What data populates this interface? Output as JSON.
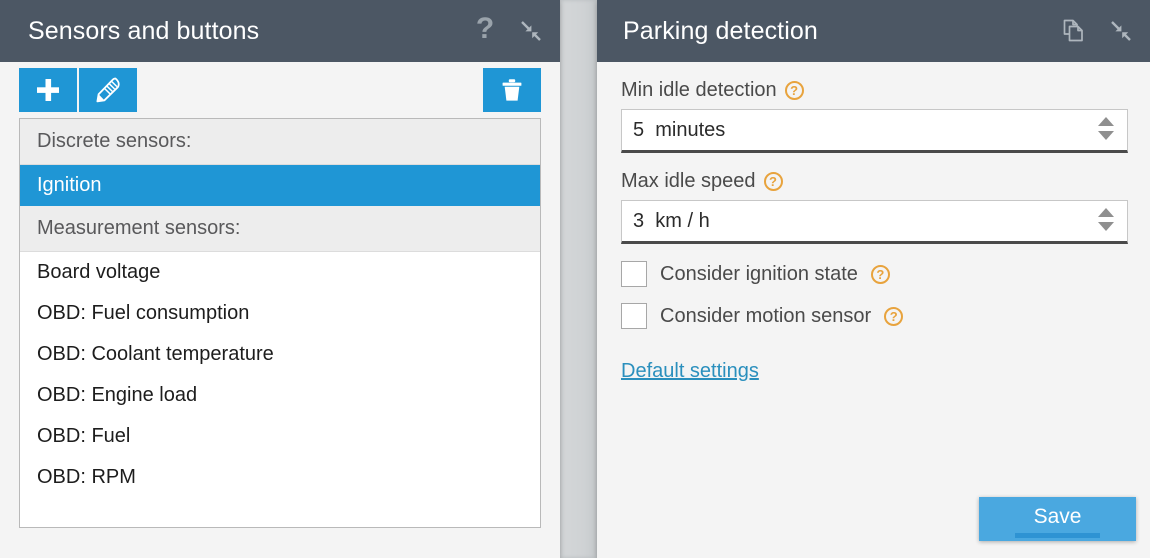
{
  "left_panel": {
    "title": "Sensors and buttons",
    "header_icons": [
      {
        "name": "help-icon",
        "glyph": "?"
      },
      {
        "name": "collapse-icon",
        "glyph": "collapse"
      }
    ],
    "toolbar": {
      "add_label": "add-sensor",
      "edit_label": "edit-sensor",
      "delete_label": "delete-sensor"
    },
    "groups": [
      {
        "header": "Discrete sensors:",
        "items": [
          {
            "label": "Ignition",
            "selected": true
          }
        ]
      },
      {
        "header": "Measurement sensors:",
        "items": [
          {
            "label": "Board voltage",
            "selected": false
          },
          {
            "label": "OBD: Fuel consumption",
            "selected": false
          },
          {
            "label": "OBD: Coolant temperature",
            "selected": false
          },
          {
            "label": "OBD: Engine load",
            "selected": false
          },
          {
            "label": "OBD: Fuel",
            "selected": false
          },
          {
            "label": "OBD: RPM",
            "selected": false
          }
        ]
      }
    ]
  },
  "right_panel": {
    "title": "Parking detection",
    "header_icons": [
      {
        "name": "copy-icon",
        "glyph": "copy"
      },
      {
        "name": "collapse-icon",
        "glyph": "collapse"
      }
    ],
    "fields": [
      {
        "label": "Min idle detection",
        "value": "5  minutes",
        "help": "?"
      },
      {
        "label": "Max idle speed",
        "value": "3  km / h",
        "help": "?"
      }
    ],
    "checkboxes": [
      {
        "label": "Consider ignition state",
        "checked": false,
        "help": "?"
      },
      {
        "label": "Consider motion sensor",
        "checked": false,
        "help": "?"
      }
    ],
    "default_link": "Default settings",
    "save_label": "Save"
  },
  "colors": {
    "header_bg": "#4c5764",
    "accent_blue": "#1f96d5",
    "save_blue": "#4aa8e0",
    "save_underline": "#2e93d3",
    "help_orange": "#e8a33d",
    "link_blue": "#2a8fbd",
    "panel_bg": "#f4f4f4",
    "group_header_bg": "#ededed"
  }
}
